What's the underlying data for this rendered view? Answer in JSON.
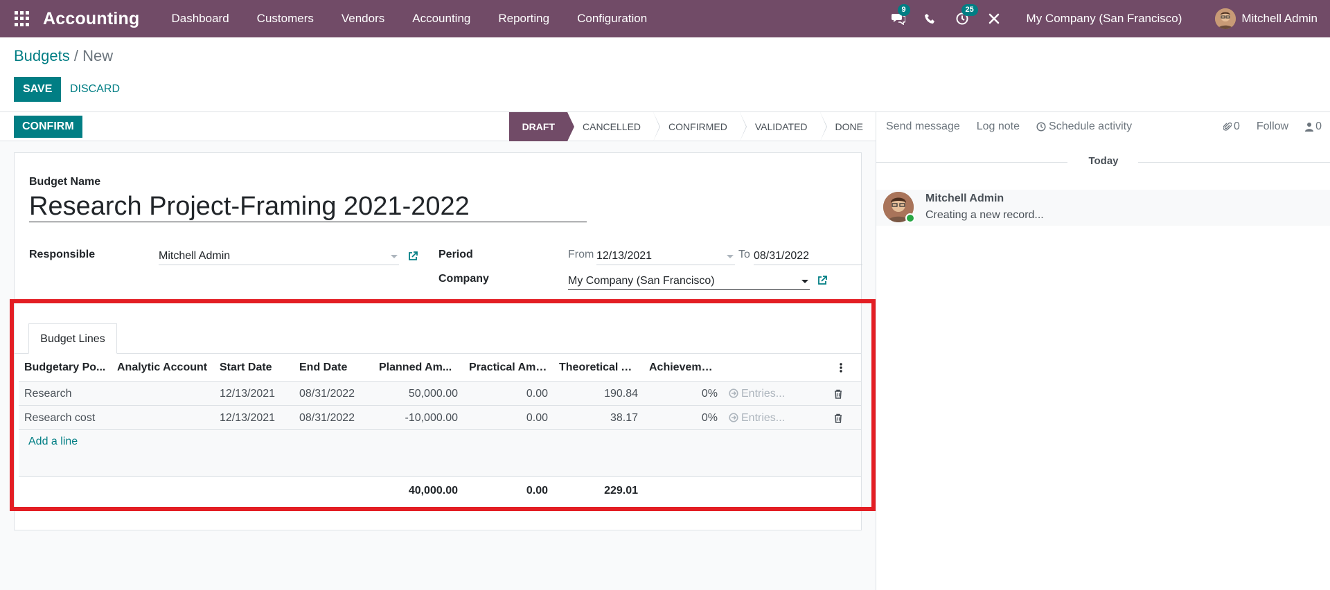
{
  "navbar": {
    "brand": "Accounting",
    "menu": [
      "Dashboard",
      "Customers",
      "Vendors",
      "Accounting",
      "Reporting",
      "Configuration"
    ],
    "messages_count": "9",
    "activities_count": "25",
    "company": "My Company (San Francisco)",
    "user": "Mitchell Admin",
    "bg_color": "#714b67"
  },
  "breadcrumb": {
    "parent": "Budgets",
    "separator": "/",
    "current": "New"
  },
  "actions": {
    "save": "SAVE",
    "discard": "DISCARD",
    "confirm": "CONFIRM"
  },
  "stages": [
    "DRAFT",
    "CANCELLED",
    "CONFIRMED",
    "VALIDATED",
    "DONE"
  ],
  "active_stage": "DRAFT",
  "form": {
    "budget_name_label": "Budget Name",
    "budget_name": "Research Project-Framing 2021-2022",
    "responsible_label": "Responsible",
    "responsible": "Mitchell Admin",
    "period_label": "Period",
    "period_from_label": "From",
    "period_from": "12/13/2021",
    "period_to_label": "To",
    "period_to": "08/31/2022",
    "company_label": "Company",
    "company": "My Company (San Francisco)"
  },
  "notebook": {
    "tab": "Budget Lines",
    "columns": [
      "Budgetary Po...",
      "Analytic Account",
      "Start Date",
      "End Date",
      "Planned Am...",
      "Practical Amo...",
      "Theoretical A...",
      "Achievement"
    ],
    "rows": [
      {
        "position": "Research",
        "analytic": "",
        "start": "12/13/2021",
        "end": "08/31/2022",
        "planned": "50,000.00",
        "practical": "0.00",
        "theoretical": "190.84",
        "achievement": "0%",
        "entries": "Entries..."
      },
      {
        "position": "Research cost",
        "analytic": "",
        "start": "12/13/2021",
        "end": "08/31/2022",
        "planned": "-10,000.00",
        "practical": "0.00",
        "theoretical": "38.17",
        "achievement": "0%",
        "entries": "Entries..."
      }
    ],
    "add_line": "Add a line",
    "totals": {
      "planned": "40,000.00",
      "practical": "0.00",
      "theoretical": "229.01"
    }
  },
  "chatter": {
    "send_message": "Send message",
    "log_note": "Log note",
    "schedule_activity": "Schedule activity",
    "attachments": "0",
    "follow": "Follow",
    "followers": "0",
    "today": "Today",
    "message_author": "Mitchell Admin",
    "message_body": "Creating a new record..."
  }
}
